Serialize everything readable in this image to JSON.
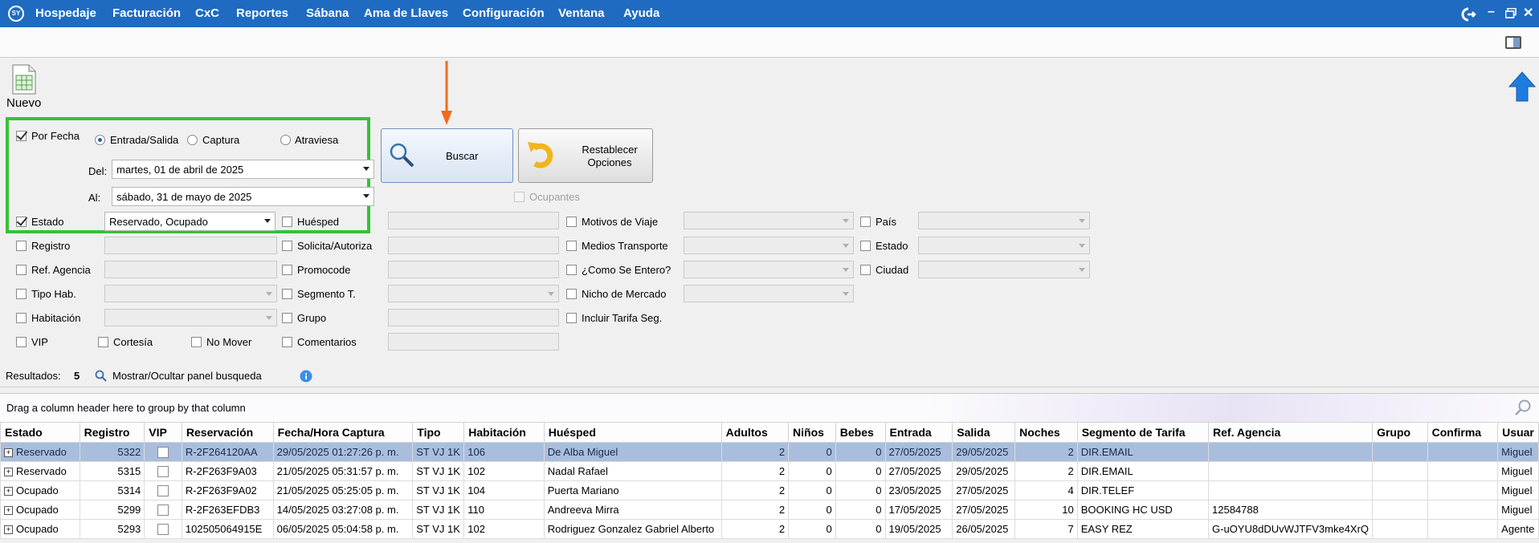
{
  "menu": {
    "logo": "SY",
    "items": [
      "Hospedaje",
      "Facturación",
      "CxC",
      "Reportes",
      "Sábana",
      "Ama de Llaves",
      "Configuración",
      "Ventana",
      "Ayuda"
    ]
  },
  "toolbar": {
    "new_label": "Nuevo"
  },
  "filters": {
    "por_fecha": "Por Fecha",
    "radio_entrada": "Entrada/Salida",
    "radio_captura": "Captura",
    "radio_atraviesa": "Atraviesa",
    "del_label": "Del:",
    "del_value": "martes, 01 de abril de 2025",
    "al_label": "Al:",
    "al_value": "sábado, 31 de mayo de 2025",
    "estado_label": "Estado",
    "estado_value": "Reservado, Ocupado",
    "registro": "Registro",
    "ref_agencia": "Ref. Agencia",
    "tipo_hab": "Tipo Hab.",
    "habitacion": "Habitación",
    "vip": "VIP",
    "cortesia": "Cortesía",
    "no_mover": "No Mover",
    "huesped": "Huésped",
    "solicita": "Solicita/Autoriza",
    "promocode": "Promocode",
    "segmento": "Segmento T.",
    "grupo": "Grupo",
    "comentarios": "Comentarios",
    "motivos": "Motivos de Viaje",
    "medios": "Medios Transporte",
    "como": "¿Como Se Entero?",
    "nicho": "Nicho de Mercado",
    "incluir": "Incluir Tarifa Seg.",
    "pais": "País",
    "estado2": "Estado",
    "ciudad": "Ciudad",
    "ocupantes": "Ocupantes"
  },
  "buttons": {
    "buscar": "Buscar",
    "restablecer_1": "Restablecer",
    "restablecer_2": "Opciones"
  },
  "results": {
    "label": "Resultados:",
    "count": "5",
    "toggle": "Mostrar/Ocultar panel busqueda"
  },
  "group_panel": {
    "hint": "Drag a column header here to group by that column"
  },
  "grid": {
    "columns": [
      "Estado",
      "Registro",
      "VIP",
      "Reservación",
      "Fecha/Hora Captura",
      "Tipo",
      "Habitación",
      "Huésped",
      "Adultos",
      "Niños",
      "Bebes",
      "Entrada",
      "Salida",
      "Noches",
      "Segmento de Tarifa",
      "Ref. Agencia",
      "Grupo",
      "Confirma",
      "Usuar"
    ],
    "rows": [
      [
        "Reservado",
        "5322",
        "",
        "R-2F264120AA",
        "29/05/2025 01:27:26 p. m.",
        "ST VJ 1K",
        "106",
        "De Alba Miguel",
        "2",
        "0",
        "0",
        "27/05/2025",
        "29/05/2025",
        "2",
        "DIR.EMAIL",
        "",
        "",
        "",
        "Miguel"
      ],
      [
        "Reservado",
        "5315",
        "",
        "R-2F263F9A03",
        "21/05/2025 05:31:57 p. m.",
        "ST VJ 1K",
        "102",
        "Nadal Rafael",
        "2",
        "0",
        "0",
        "27/05/2025",
        "29/05/2025",
        "2",
        "DIR.EMAIL",
        "",
        "",
        "",
        "Miguel"
      ],
      [
        "Ocupado",
        "5314",
        "",
        "R-2F263F9A02",
        "21/05/2025 05:25:05 p. m.",
        "ST VJ 1K",
        "104",
        "Puerta Mariano",
        "2",
        "0",
        "0",
        "23/05/2025",
        "27/05/2025",
        "4",
        "DIR.TELEF",
        "",
        "",
        "",
        "Miguel"
      ],
      [
        "Ocupado",
        "5299",
        "",
        "R-2F263EFDB3",
        "14/05/2025 03:27:08 p. m.",
        "ST VJ 1K",
        "110",
        "Andreeva Mirra",
        "2",
        "0",
        "0",
        "17/05/2025",
        "27/05/2025",
        "10",
        "BOOKING HC USD",
        "12584788",
        "",
        "",
        "Miguel"
      ],
      [
        "Ocupado",
        "5293",
        "",
        "102505064915E",
        "06/05/2025 05:04:58 p. m.",
        "ST VJ 1K",
        "102",
        "Rodriguez Gonzalez Gabriel Alberto",
        "2",
        "0",
        "0",
        "19/05/2025",
        "26/05/2025",
        "7",
        "EASY REZ",
        "G-uOYU8dDUvWJTFV3mke4XrQ",
        "",
        "",
        "Agente"
      ]
    ]
  },
  "colors": {
    "menubar": "#1f6bc2",
    "highlight_border": "#36c136",
    "arrow": "#f26b1d",
    "selected_row": "#a9bedd"
  }
}
